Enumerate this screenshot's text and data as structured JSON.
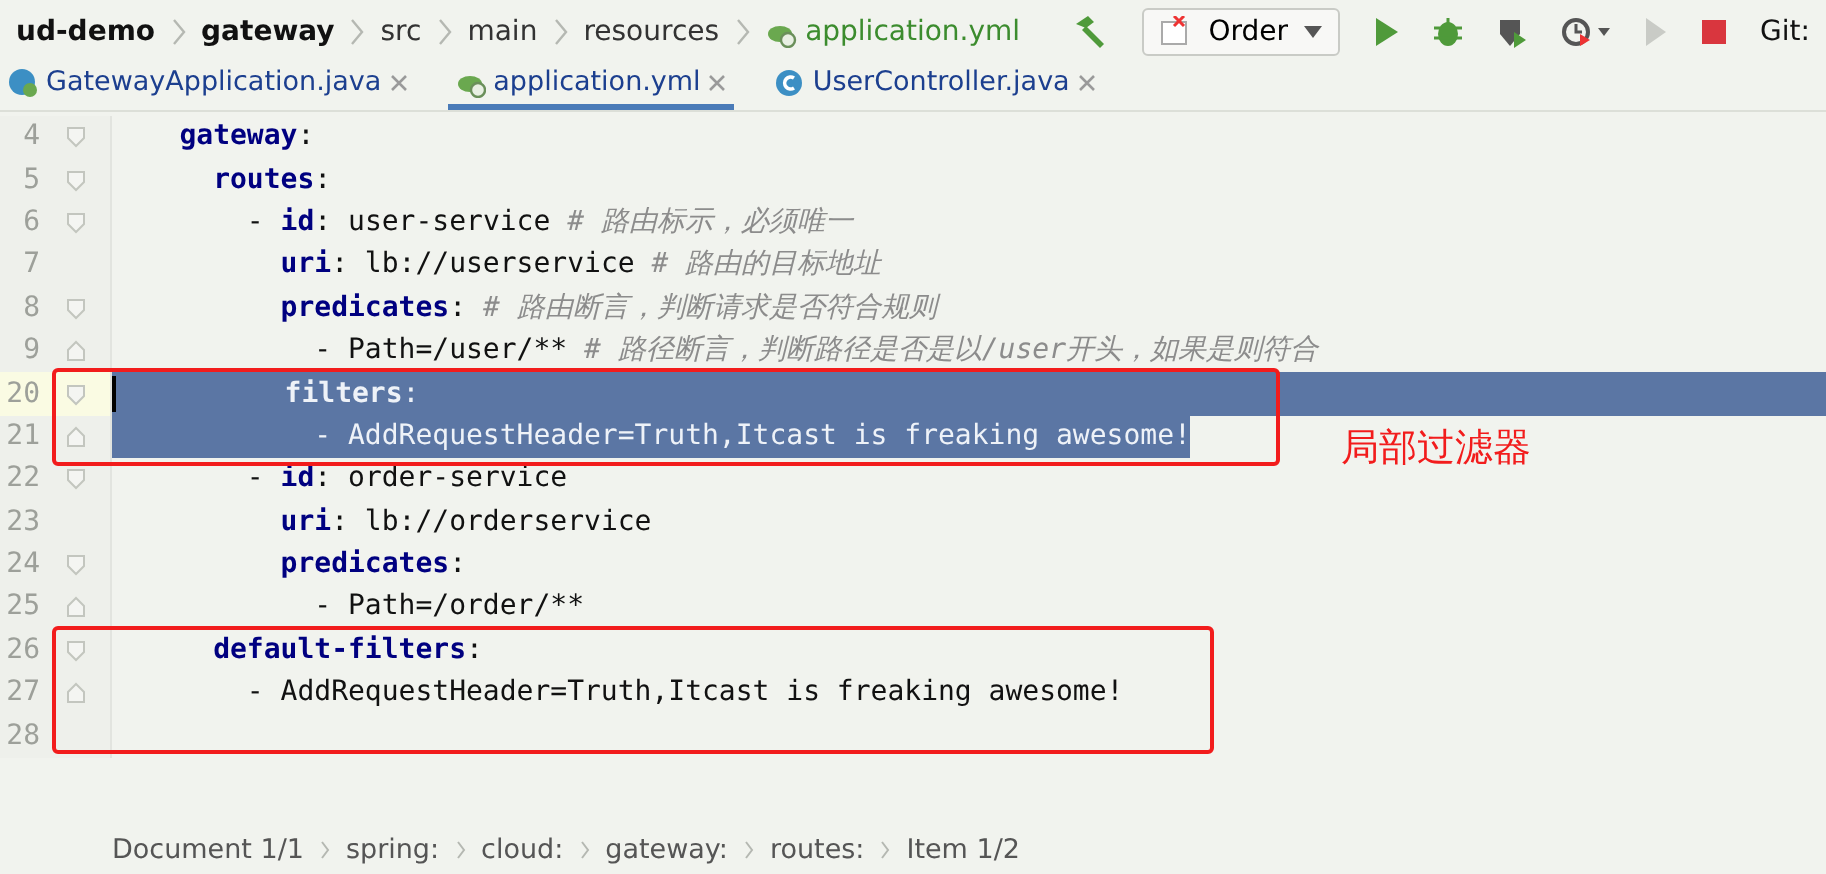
{
  "breadcrumbs": [
    {
      "label": "ud-demo",
      "kind": "module"
    },
    {
      "label": "gateway",
      "kind": "module"
    },
    {
      "label": "src",
      "kind": "folder"
    },
    {
      "label": "main",
      "kind": "folder"
    },
    {
      "label": "resources",
      "kind": "folder"
    },
    {
      "label": "application.yml",
      "kind": "file"
    }
  ],
  "toolbar": {
    "run_config": "Order",
    "git": "Git:"
  },
  "tabs": [
    {
      "label": "GatewayApplication.java",
      "kind": "java-app",
      "selected": false
    },
    {
      "label": "application.yml",
      "kind": "yaml",
      "selected": true
    },
    {
      "label": "UserController.java",
      "kind": "java-class",
      "selected": false
    }
  ],
  "lines": [
    {
      "number": "4",
      "fold_start": true,
      "fold_end": false,
      "caret": false,
      "selected": false,
      "boxed": false,
      "tokens": [
        {
          "kind": "key",
          "text": "    gateway"
        },
        {
          "kind": "text",
          "text": ":"
        }
      ]
    },
    {
      "number": "5",
      "fold_start": true,
      "fold_end": false,
      "caret": false,
      "selected": false,
      "boxed": false,
      "tokens": [
        {
          "kind": "key",
          "text": "      routes"
        },
        {
          "kind": "text",
          "text": ":"
        }
      ]
    },
    {
      "number": "6",
      "fold_start": true,
      "fold_end": false,
      "caret": false,
      "selected": false,
      "boxed": false,
      "tokens": [
        {
          "kind": "text",
          "text": "        - "
        },
        {
          "kind": "key",
          "text": "id"
        },
        {
          "kind": "text",
          "text": ": user-service "
        },
        {
          "kind": "comment",
          "text": "# 路由标示，必须唯一"
        }
      ]
    },
    {
      "number": "7",
      "fold_start": false,
      "fold_end": false,
      "caret": false,
      "selected": false,
      "boxed": false,
      "tokens": [
        {
          "kind": "key",
          "text": "          uri"
        },
        {
          "kind": "text",
          "text": ": lb://userservice "
        },
        {
          "kind": "comment",
          "text": "# 路由的目标地址"
        }
      ]
    },
    {
      "number": "8",
      "fold_start": true,
      "fold_end": false,
      "caret": false,
      "selected": false,
      "boxed": false,
      "tokens": [
        {
          "kind": "key",
          "text": "          predicates"
        },
        {
          "kind": "text",
          "text": ": "
        },
        {
          "kind": "comment",
          "text": "# 路由断言，判断请求是否符合规则"
        }
      ]
    },
    {
      "number": "9",
      "fold_start": false,
      "fold_end": true,
      "caret": false,
      "selected": false,
      "boxed": false,
      "tokens": [
        {
          "kind": "text",
          "text": "            - Path=/user/** "
        },
        {
          "kind": "comment",
          "text": "# 路径断言，判断路径是否是以/user开头，如果是则符合"
        }
      ]
    },
    {
      "number": "20",
      "fold_start": true,
      "fold_end": false,
      "caret": true,
      "selected": true,
      "newline_selected": true,
      "boxed": true,
      "tokens": [
        {
          "kind": "key",
          "text": "          filters"
        },
        {
          "kind": "text",
          "text": ":"
        }
      ]
    },
    {
      "number": "21",
      "fold_start": false,
      "fold_end": true,
      "caret": false,
      "selected": true,
      "newline_selected": false,
      "boxed": true,
      "note": "局部过滤器",
      "tokens": [
        {
          "kind": "text",
          "text": "            - AddRequestHeader=Truth,Itcast is freaking awesome!"
        }
      ]
    },
    {
      "number": "22",
      "fold_start": true,
      "fold_end": false,
      "caret": false,
      "selected": false,
      "boxed": false,
      "tokens": [
        {
          "kind": "text",
          "text": "        - "
        },
        {
          "kind": "key",
          "text": "id"
        },
        {
          "kind": "text",
          "text": ": order-service"
        }
      ]
    },
    {
      "number": "23",
      "fold_start": false,
      "fold_end": false,
      "caret": false,
      "selected": false,
      "boxed": false,
      "tokens": [
        {
          "kind": "key",
          "text": "          uri"
        },
        {
          "kind": "text",
          "text": ": lb://orderservice"
        }
      ]
    },
    {
      "number": "24",
      "fold_start": true,
      "fold_end": false,
      "caret": false,
      "selected": false,
      "boxed": false,
      "tokens": [
        {
          "kind": "key",
          "text": "          predicates"
        },
        {
          "kind": "text",
          "text": ":"
        }
      ]
    },
    {
      "number": "25",
      "fold_start": false,
      "fold_end": true,
      "caret": false,
      "selected": false,
      "boxed": false,
      "tokens": [
        {
          "kind": "text",
          "text": "            - Path=/order/**"
        }
      ]
    },
    {
      "number": "26",
      "fold_start": true,
      "fold_end": false,
      "caret": false,
      "selected": false,
      "boxed": true,
      "tokens": [
        {
          "kind": "key",
          "text": "      default-filters"
        },
        {
          "kind": "text",
          "text": ":"
        }
      ]
    },
    {
      "number": "27",
      "fold_start": false,
      "fold_end": true,
      "caret": false,
      "selected": false,
      "boxed": true,
      "tokens": [
        {
          "kind": "text",
          "text": "        - AddRequestHeader=Truth,Itcast is freaking awesome!"
        }
      ]
    },
    {
      "number": "28",
      "fold_start": false,
      "fold_end": false,
      "caret": false,
      "selected": false,
      "boxed": true
    }
  ],
  "status_path": [
    "Document 1/1",
    "spring:",
    "cloud:",
    "gateway:",
    "routes:",
    "Item 1/2"
  ]
}
